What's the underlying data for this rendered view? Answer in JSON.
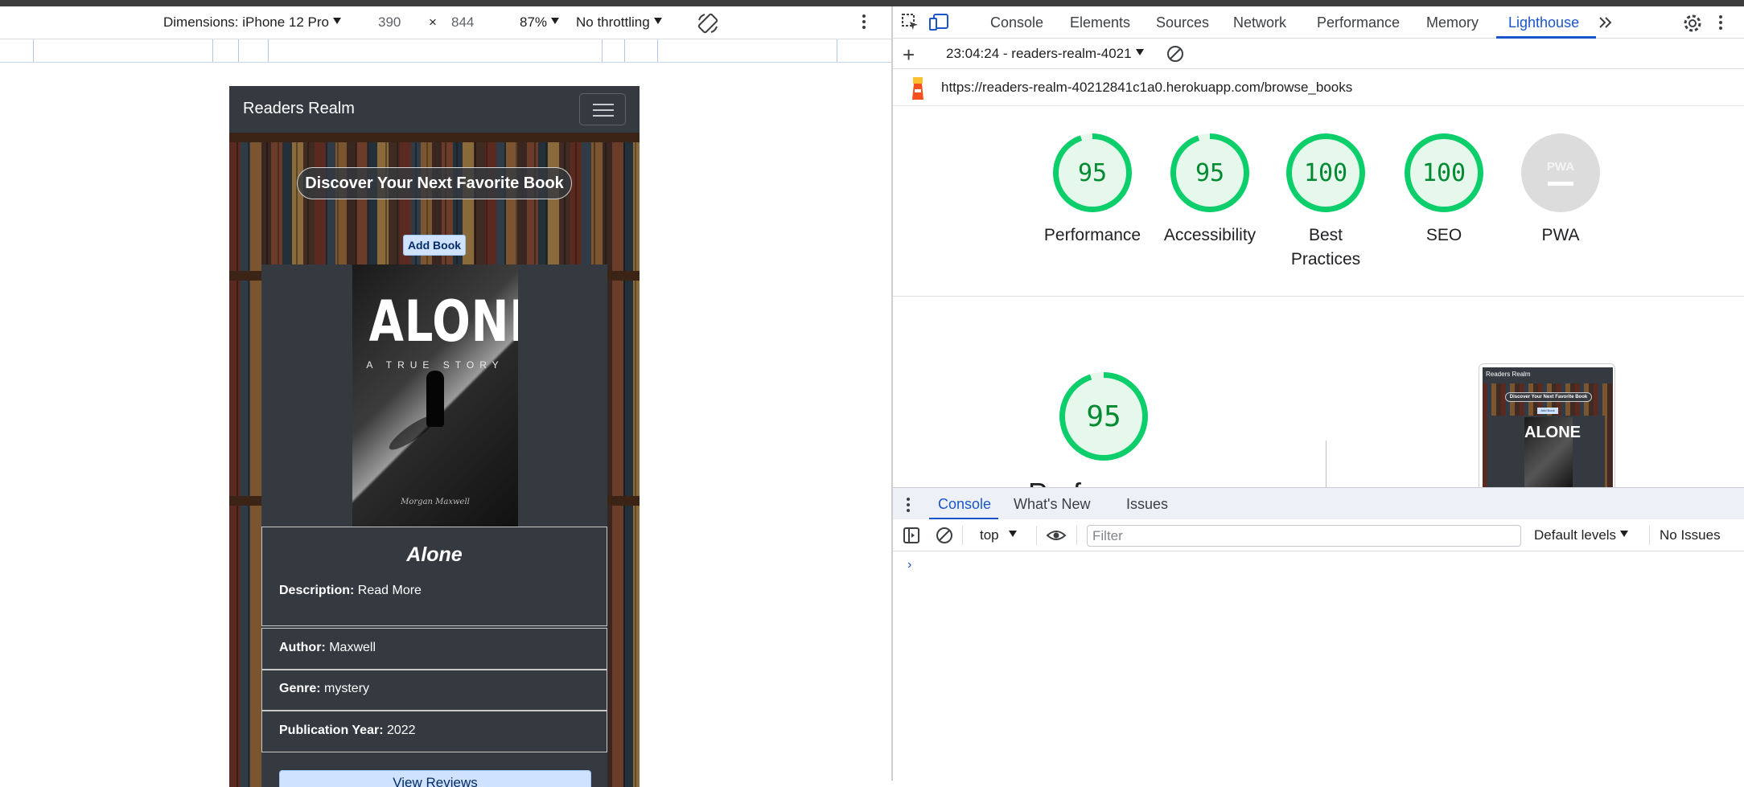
{
  "device_toolbar": {
    "dimensions_label": "Dimensions: iPhone 12 Pro",
    "width": "390",
    "times": "×",
    "height": "844",
    "zoom": "87%",
    "throttling": "No throttling"
  },
  "app": {
    "brand": "Readers Realm",
    "hero_title": "Discover Your Next Favorite Book",
    "add_book": "Add Book",
    "book": {
      "cover_title": "ALONE",
      "cover_subtitle": "A TRUE STORY",
      "cover_author_signature": "Morgan Maxwell",
      "title": "Alone",
      "description_label": "Description:",
      "description_link": "Read More",
      "author_label": "Author:",
      "author": "Maxwell",
      "genre_label": "Genre:",
      "genre": "mystery",
      "year_label": "Publication Year:",
      "year": "2022"
    },
    "view_reviews": "View Reviews"
  },
  "devtools": {
    "tabs": [
      "Console",
      "Elements",
      "Sources",
      "Network",
      "Performance",
      "Memory",
      "Lighthouse"
    ],
    "active_tab": "Lighthouse",
    "report_label": "23:04:24 - readers-realm-4021",
    "url": "https://readers-realm-40212841c1a0.herokuapp.com/browse_books",
    "scores": [
      {
        "label": "Performance",
        "value": "95",
        "fraction": 0.95
      },
      {
        "label": "Accessibility",
        "value": "95",
        "fraction": 0.95
      },
      {
        "label": "Best Practices",
        "value": "100",
        "fraction": 1.0
      },
      {
        "label": "SEO",
        "value": "100",
        "fraction": 1.0
      }
    ],
    "pwa_label": "PWA",
    "pwa_icon_text": "PWA",
    "detail_score": "95",
    "detail_category": "Performance",
    "thumbnail": {
      "brand": "Readers Realm",
      "title": "Discover Your Next Favorite Book",
      "add": "Add Book",
      "cover": "ALONE"
    },
    "drawer_tabs": [
      "Console",
      "What's New",
      "Issues"
    ],
    "drawer_active": "Console",
    "context": "top",
    "filter_placeholder": "Filter",
    "levels": "Default levels",
    "issues": "No Issues",
    "prompt": "›"
  },
  "colors": {
    "score_green": "#0cce6b",
    "score_text": "#008a32",
    "accent_blue": "#1a56c9",
    "navbar": "#343a40"
  }
}
